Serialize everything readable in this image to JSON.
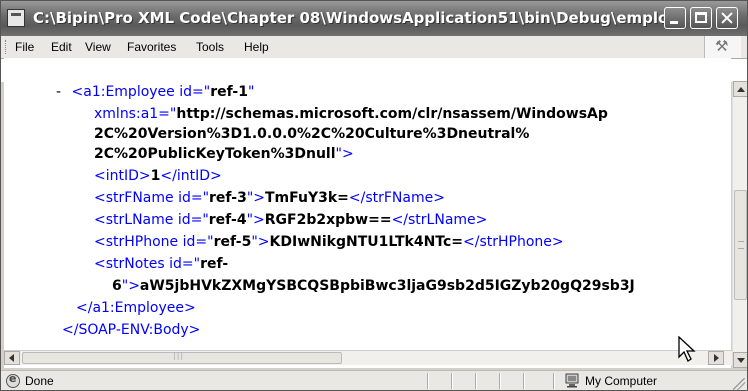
{
  "window": {
    "title": "C:\\Bipin\\Pro XML Code\\Chapter 08\\WindowsApplication51\\bin\\Debug\\emplo..."
  },
  "menu": {
    "items": [
      "File",
      "Edit",
      "View",
      "Favorites",
      "Tools",
      "Help"
    ]
  },
  "xml": {
    "l1_minus": "-",
    "l1_tag": "<a1:Employee id=\"",
    "l1_val": "ref-1",
    "l1_end": "\"",
    "l2_attr": "xmlns:a1=\"",
    "l2_val": "http://schemas.microsoft.com/clr/nsassem/WindowsAp",
    "l3_val": "2C%20Version%3D1.0.0.0%2C%20Culture%3Dneutral%",
    "l4_val": "2C%20PublicKeyToken%3Dnull",
    "l4_end": "\">",
    "l5_open": "<intID>",
    "l5_val": "1",
    "l5_close": "</intID>",
    "l6_open": "<strFName id=\"",
    "l6_id": "ref-3",
    "l6_mid": "\">",
    "l6_val": "TmFuY3k=",
    "l6_close": "</strFName>",
    "l7_open": "<strLName id=\"",
    "l7_id": "ref-4",
    "l7_mid": "\">",
    "l7_val": "RGF2b2xpbw==",
    "l7_close": "</strLName>",
    "l8_open": "<strHPhone id=\"",
    "l8_id": "ref-5",
    "l8_mid": "\">",
    "l8_val": "KDIwNikgNTU1LTk4NTc=",
    "l8_close": "</strHPhone>",
    "l9_open": "<strNotes id=\"",
    "l9_id": "ref-",
    "l10_id": "6",
    "l10_mid": "\">",
    "l10_val": "aW5jbHVkZXMgYSBCQSBpbiBwc3ljaG9sb2d5IGZyb20gQ29sb3J",
    "l11": "</a1:Employee>",
    "l12": "</SOAP-ENV:Body>"
  },
  "status": {
    "text": "Done",
    "zone": "My Computer"
  },
  "icons": {
    "title": "ie-document-icon",
    "status": "ie-page-icon",
    "zone": "my-computer-icon",
    "cursor": "mouse-pointer-icon"
  }
}
